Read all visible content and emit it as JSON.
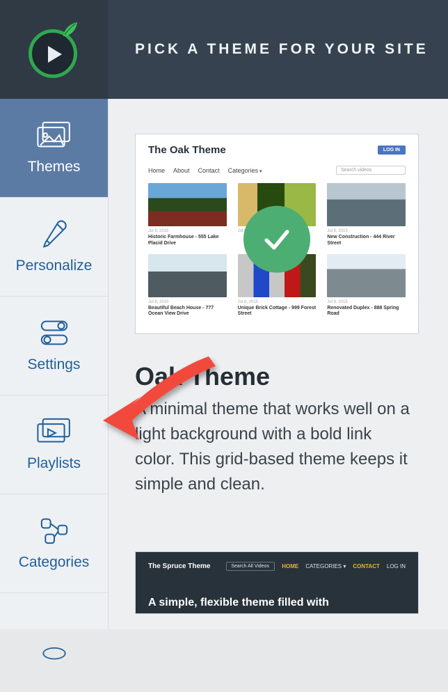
{
  "header": {
    "title": "PICK A THEME FOR YOUR SITE"
  },
  "sidebar": {
    "items": [
      {
        "label": "Themes"
      },
      {
        "label": "Personalize"
      },
      {
        "label": "Settings"
      },
      {
        "label": "Playlists"
      },
      {
        "label": "Categories"
      }
    ]
  },
  "oak": {
    "preview": {
      "title": "The Oak Theme",
      "login": "LOG IN",
      "nav": {
        "home": "Home",
        "about": "About",
        "contact": "Contact",
        "categories": "Categories"
      },
      "search_placeholder": "Search videos",
      "cards": [
        {
          "date": "Jul 8, 2015",
          "caption": "Historic Farmhouse - 555 Lake Placid Drive"
        },
        {
          "date": "Jul 8, 2015",
          "caption": ""
        },
        {
          "date": "Jul 8, 2015",
          "caption": "New Construction - 444 River Street"
        },
        {
          "date": "Jul 8, 2015",
          "caption": "Beautiful Beach House - 777 Ocean View Drive"
        },
        {
          "date": "Jul 8, 2015",
          "caption": "Unique Brick Cottage - 999 Forest Street"
        },
        {
          "date": "Jul 8, 2015",
          "caption": "Renovated Duplex - 888 Spring Road"
        }
      ]
    },
    "heading": "Oak Theme",
    "description": "A minimal theme that works well on a light background with a bold link color. This grid-based theme keeps it simple and clean."
  },
  "spruce": {
    "title": "The Spruce Theme",
    "links": {
      "home": "HOME",
      "categories": "CATEGORIES ▾",
      "contact": "CONTACT",
      "login": "LOG IN"
    },
    "search_placeholder": "Search All Videos",
    "tagline": "A simple, flexible theme filled with"
  },
  "colors": {
    "accent": "#4cae72",
    "sidebar_active": "#5b7ba5",
    "link": "#1f5f9c"
  }
}
